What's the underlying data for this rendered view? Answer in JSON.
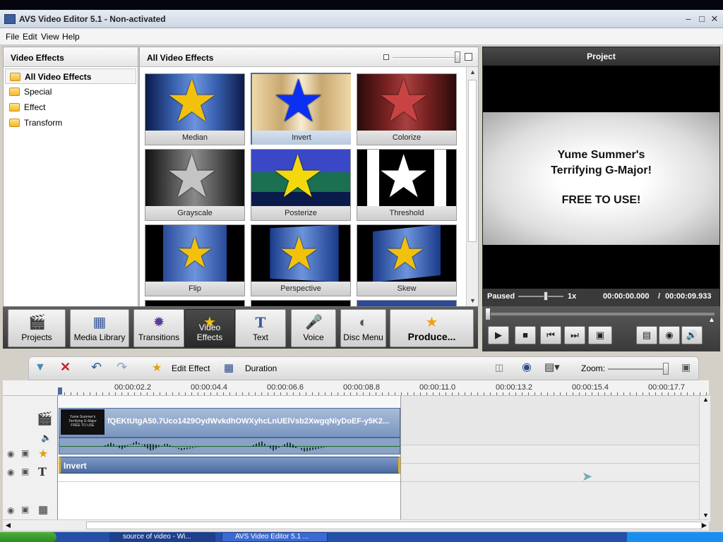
{
  "window": {
    "title": "AVS Video Editor 5.1 - Non-activated"
  },
  "menu": [
    "File",
    "Edit",
    "View",
    "Help"
  ],
  "categories": {
    "header": "Video Effects",
    "items": [
      "All Video Effects",
      "Special",
      "Effect",
      "Transform"
    ],
    "selected": "All Video Effects"
  },
  "effects": {
    "header": "All Video Effects",
    "tiles": [
      "Median",
      "Invert",
      "Colorize",
      "Grayscale",
      "Posterize",
      "Threshold",
      "Flip",
      "Perspective",
      "Skew"
    ],
    "selected": "Invert"
  },
  "project": {
    "header": "Project",
    "preview_lines": [
      "Yume Summer's",
      "Terrifying G-Major!",
      "FREE TO USE!"
    ],
    "status": "Paused",
    "speed": "1x",
    "time_current": "00:00:00.000",
    "time_separator": "/",
    "time_total": "00:00:09.933"
  },
  "toolbar": {
    "buttons": [
      "Projects",
      "Media Library",
      "Transitions",
      "Video Effects",
      "Text",
      "Voice",
      "Disc Menu",
      "Produce..."
    ],
    "active": "Video Effects"
  },
  "timeline": {
    "edit_effect": "Edit Effect",
    "duration": "Duration",
    "zoom_label": "Zoom:",
    "ruler": [
      "00:00:02.2",
      "00:00:04.4",
      "00:00:06.6",
      "00:00:08.8",
      "00:00:11.0",
      "00:00:13.2",
      "00:00:15.4",
      "00:00:17.7"
    ],
    "clip_name": "fQEKtUtgA50.7Uco1429OydWvkdhOWXyhcLnUElVsb2XwgqNiyDoEF-y5K2...",
    "clip_thumb_lines": [
      "Yume Summer's",
      "Terrifying G-Major",
      "FREE TO USE"
    ],
    "effect_clip": "Invert"
  },
  "taskbar": {
    "tasks": [
      "source of video - Wi...",
      "AVS Video Editor 5.1 ..."
    ]
  }
}
